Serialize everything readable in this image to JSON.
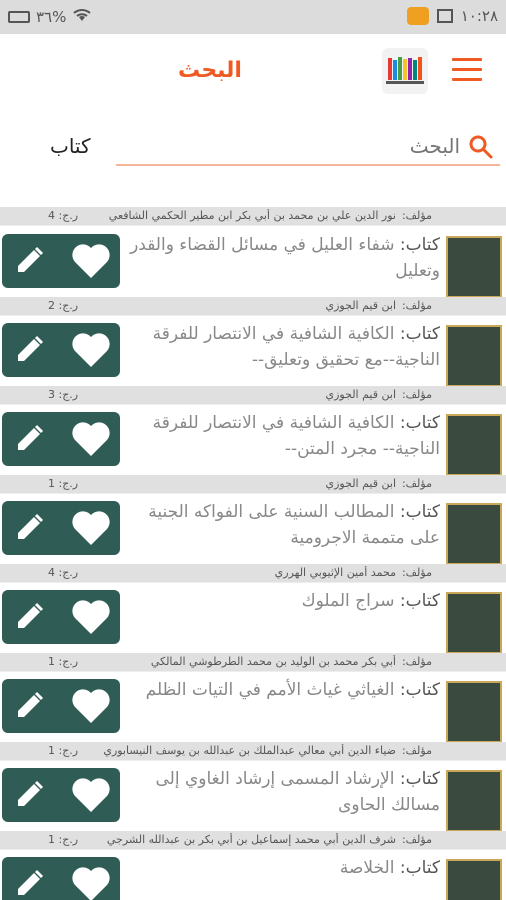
{
  "status": {
    "battery": "٣٦%",
    "time": "١٠:٢٨"
  },
  "header": {
    "title": "البحث"
  },
  "search": {
    "placeholder": "البحث",
    "filter_label": "كتاب"
  },
  "labels": {
    "book_prefix": "كتاب:",
    "author_prefix": "مؤلف:",
    "count_prefix": "ر.ج:"
  },
  "partial_row": {
    "author": "نور الدين علي بن محمد بن أبي بكر ابن مطير الحكمي الشافعي",
    "count": "4"
  },
  "books": [
    {
      "title": "شفاء العليل في مسائل القضاء والقدر وتعليل",
      "author": "ابن قيم الجوزي",
      "count": "2"
    },
    {
      "title": "الكافية الشافية في الانتصار للفرقة الناجية--مع تحقيق وتعليق--",
      "author": "ابن قيم الجوزي",
      "count": "3"
    },
    {
      "title": "الكافية الشافية في الانتصار للفرقة الناجية-- مجرد المتن--",
      "author": "ابن قيم الجوزي",
      "count": "1"
    },
    {
      "title": "المطالب السنية على الفواكه الجنية على متممة الاجرومية",
      "author": "محمد أمين الإثيوبي الهرري",
      "count": "4"
    },
    {
      "title": "سراج الملوك",
      "author": "أبي بكر محمد بن الوليد بن محمد الطرطوشي المالكي",
      "count": "1"
    },
    {
      "title": "الغياثي غياث الأمم في التيات الظلم",
      "author": "ضياء الدين أبي معالي عبدالملك بن عبدالله بن يوسف النيسابوري",
      "count": "1"
    },
    {
      "title": "الإرشاد المسمى إرشاد الغاوي إلى مسالك الحاوى",
      "author": "شرف الدين أبي محمد إسماعيل بن أبي بكر بن عبدالله الشرجي",
      "count": "1"
    },
    {
      "title": "الخلاصة",
      "author": "",
      "count": ""
    }
  ]
}
